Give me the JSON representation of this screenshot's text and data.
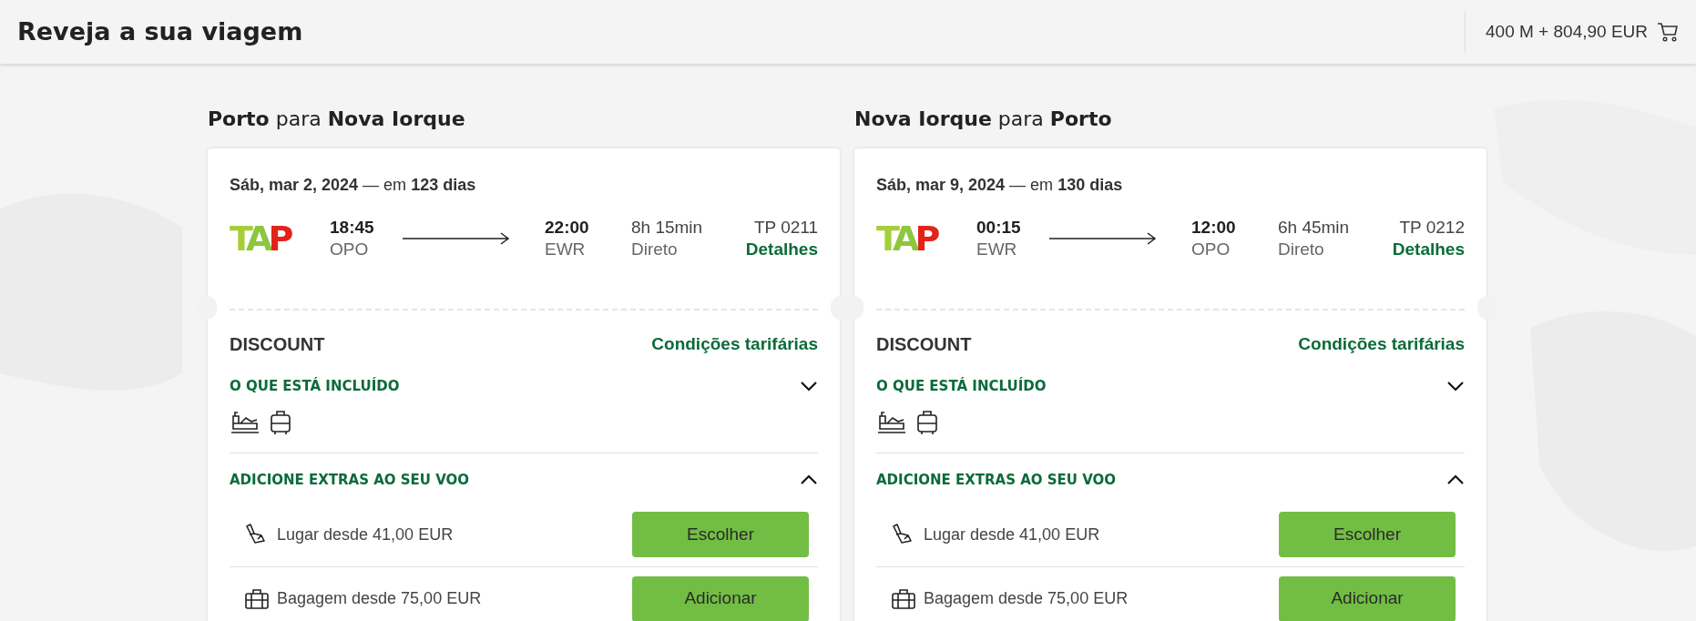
{
  "header": {
    "title": "Reveja a sua viagem",
    "cart_total": "400 M + 804,90 EUR"
  },
  "legs": [
    {
      "heading": {
        "from": "Porto",
        "connector": "para",
        "to": "Nova Iorque"
      },
      "date": "Sáb, mar 2, 2024",
      "date_sep": "— em",
      "days": "123 dias",
      "airline": "TAP",
      "departure": {
        "time": "18:45",
        "airport": "OPO"
      },
      "arrival": {
        "time": "22:00",
        "airport": "EWR"
      },
      "duration": "8h 15min",
      "stops": "Direto",
      "flight_number": "TP 0211",
      "details_link": "Detalhes",
      "fare": "DISCOUNT",
      "conditions_link": "Condições tarifárias",
      "included": {
        "title": "O QUE ESTÁ INCLUÍDO",
        "expanded": false
      },
      "extras": {
        "title": "ADICIONE EXTRAS AO SEU VOO",
        "expanded": true,
        "items": [
          {
            "kind": "seat",
            "label": "Lugar desde 41,00 EUR",
            "button": "Escolher"
          },
          {
            "kind": "baggage",
            "label": "Bagagem desde 75,00 EUR",
            "button": "Adicionar"
          }
        ]
      }
    },
    {
      "heading": {
        "from": "Nova Iorque",
        "connector": "para",
        "to": "Porto"
      },
      "date": "Sáb, mar 9, 2024",
      "date_sep": "— em",
      "days": "130 dias",
      "airline": "TAP",
      "departure": {
        "time": "00:15",
        "airport": "EWR"
      },
      "arrival": {
        "time": "12:00",
        "airport": "OPO"
      },
      "duration": "6h 45min",
      "stops": "Direto",
      "flight_number": "TP 0212",
      "details_link": "Detalhes",
      "fare": "DISCOUNT",
      "conditions_link": "Condições tarifárias",
      "included": {
        "title": "O QUE ESTÁ INCLUÍDO",
        "expanded": false
      },
      "extras": {
        "title": "ADICIONE EXTRAS AO SEU VOO",
        "expanded": true,
        "items": [
          {
            "kind": "seat",
            "label": "Lugar desde 41,00 EUR",
            "button": "Escolher"
          },
          {
            "kind": "baggage",
            "label": "Bagagem desde 75,00 EUR",
            "button": "Adicionar"
          }
        ]
      }
    }
  ]
}
